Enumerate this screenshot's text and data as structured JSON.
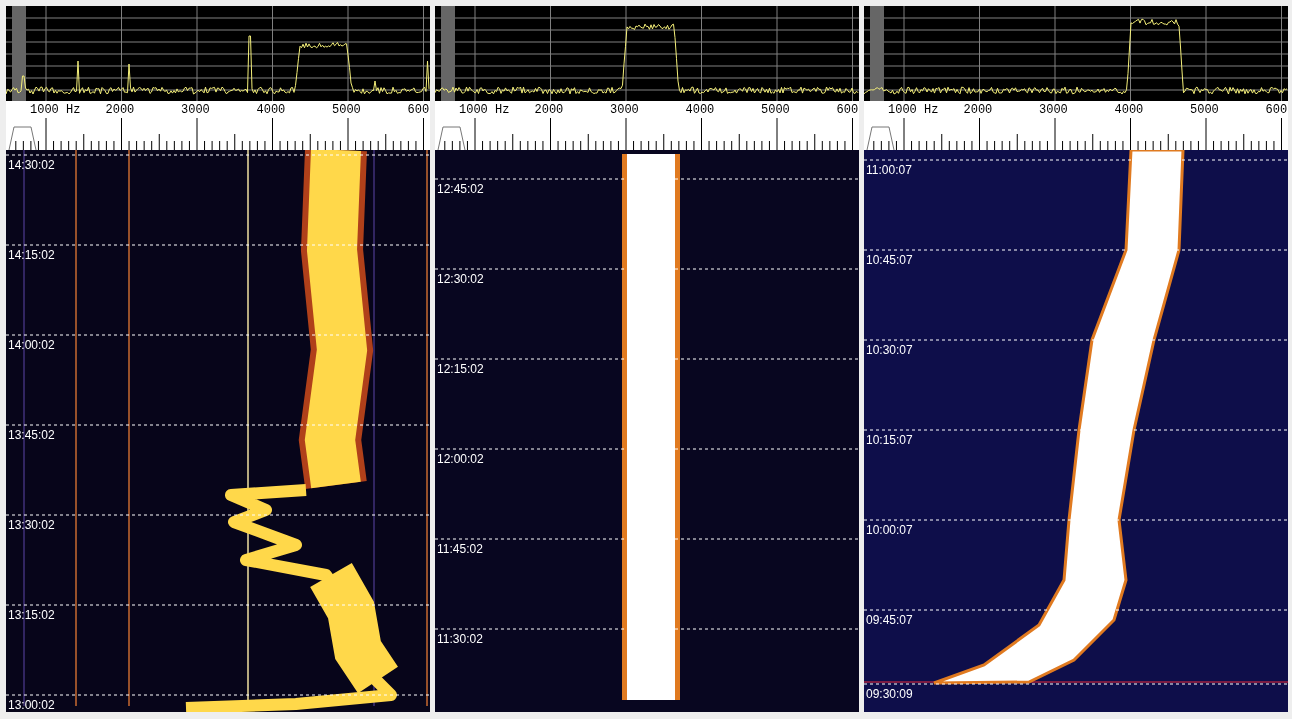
{
  "panels": [
    {
      "scale_labels": [
        "1000 Hz",
        "2000",
        "3000",
        "4000",
        "5000",
        "600"
      ],
      "time_marks": [
        "14:30:02",
        "14:15:02",
        "14:00:02",
        "13:45:02",
        "13:30:02",
        "13:15:02",
        "13:00:02"
      ]
    },
    {
      "scale_labels": [
        "1000 Hz",
        "2000",
        "3000",
        "4000",
        "5000",
        "600"
      ],
      "time_marks": [
        "12:45:02",
        "12:30:02",
        "12:15:02",
        "12:00:02",
        "11:45:02",
        "11:30:02"
      ]
    },
    {
      "scale_labels": [
        "1000 Hz",
        "2000",
        "3000",
        "4000",
        "5000",
        "600"
      ],
      "time_marks": [
        "11:00:07",
        "10:45:07",
        "10:30:07",
        "10:15:07",
        "10:00:07",
        "09:45:07",
        "09:30:09"
      ]
    }
  ]
}
